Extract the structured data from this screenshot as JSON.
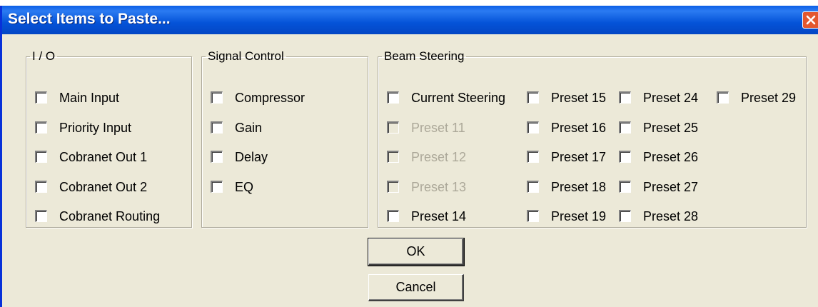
{
  "dialog": {
    "title": "Select Items to Paste...",
    "close_icon": "close-icon"
  },
  "groups": {
    "io": {
      "legend": "I / O",
      "items": [
        {
          "label": "Main Input",
          "checked": false,
          "enabled": true
        },
        {
          "label": "Priority Input",
          "checked": false,
          "enabled": true
        },
        {
          "label": "Cobranet Out 1",
          "checked": false,
          "enabled": true
        },
        {
          "label": "Cobranet Out 2",
          "checked": false,
          "enabled": true
        },
        {
          "label": "Cobranet Routing",
          "checked": false,
          "enabled": true
        }
      ]
    },
    "signal": {
      "legend": "Signal Control",
      "items": [
        {
          "label": "Compressor",
          "checked": false,
          "enabled": true
        },
        {
          "label": "Gain",
          "checked": false,
          "enabled": true
        },
        {
          "label": "Delay",
          "checked": false,
          "enabled": true
        },
        {
          "label": "EQ",
          "checked": false,
          "enabled": true
        }
      ]
    },
    "beam": {
      "legend": "Beam Steering",
      "col1": [
        {
          "label": "Current Steering",
          "checked": false,
          "enabled": true
        },
        {
          "label": "Preset 11",
          "checked": false,
          "enabled": false
        },
        {
          "label": "Preset 12",
          "checked": false,
          "enabled": false
        },
        {
          "label": "Preset 13",
          "checked": false,
          "enabled": false
        },
        {
          "label": "Preset 14",
          "checked": false,
          "enabled": true
        }
      ],
      "col2": [
        {
          "label": "Preset 15",
          "checked": false,
          "enabled": true
        },
        {
          "label": "Preset 16",
          "checked": false,
          "enabled": true
        },
        {
          "label": "Preset 17",
          "checked": false,
          "enabled": true
        },
        {
          "label": "Preset 18",
          "checked": false,
          "enabled": true
        },
        {
          "label": "Preset 19",
          "checked": false,
          "enabled": true
        }
      ],
      "col3": [
        {
          "label": "Preset 24",
          "checked": false,
          "enabled": true
        },
        {
          "label": "Preset 25",
          "checked": false,
          "enabled": true
        },
        {
          "label": "Preset 26",
          "checked": false,
          "enabled": true
        },
        {
          "label": "Preset 27",
          "checked": false,
          "enabled": true
        },
        {
          "label": "Preset 28",
          "checked": false,
          "enabled": true
        }
      ],
      "col4": [
        {
          "label": "Preset 29",
          "checked": false,
          "enabled": true
        }
      ]
    }
  },
  "buttons": {
    "ok": "OK",
    "cancel": "Cancel"
  },
  "colors": {
    "titlebar": "#0453d8",
    "face": "#ece9d8",
    "disabled_text": "#aca899",
    "close": "#e3572f"
  }
}
